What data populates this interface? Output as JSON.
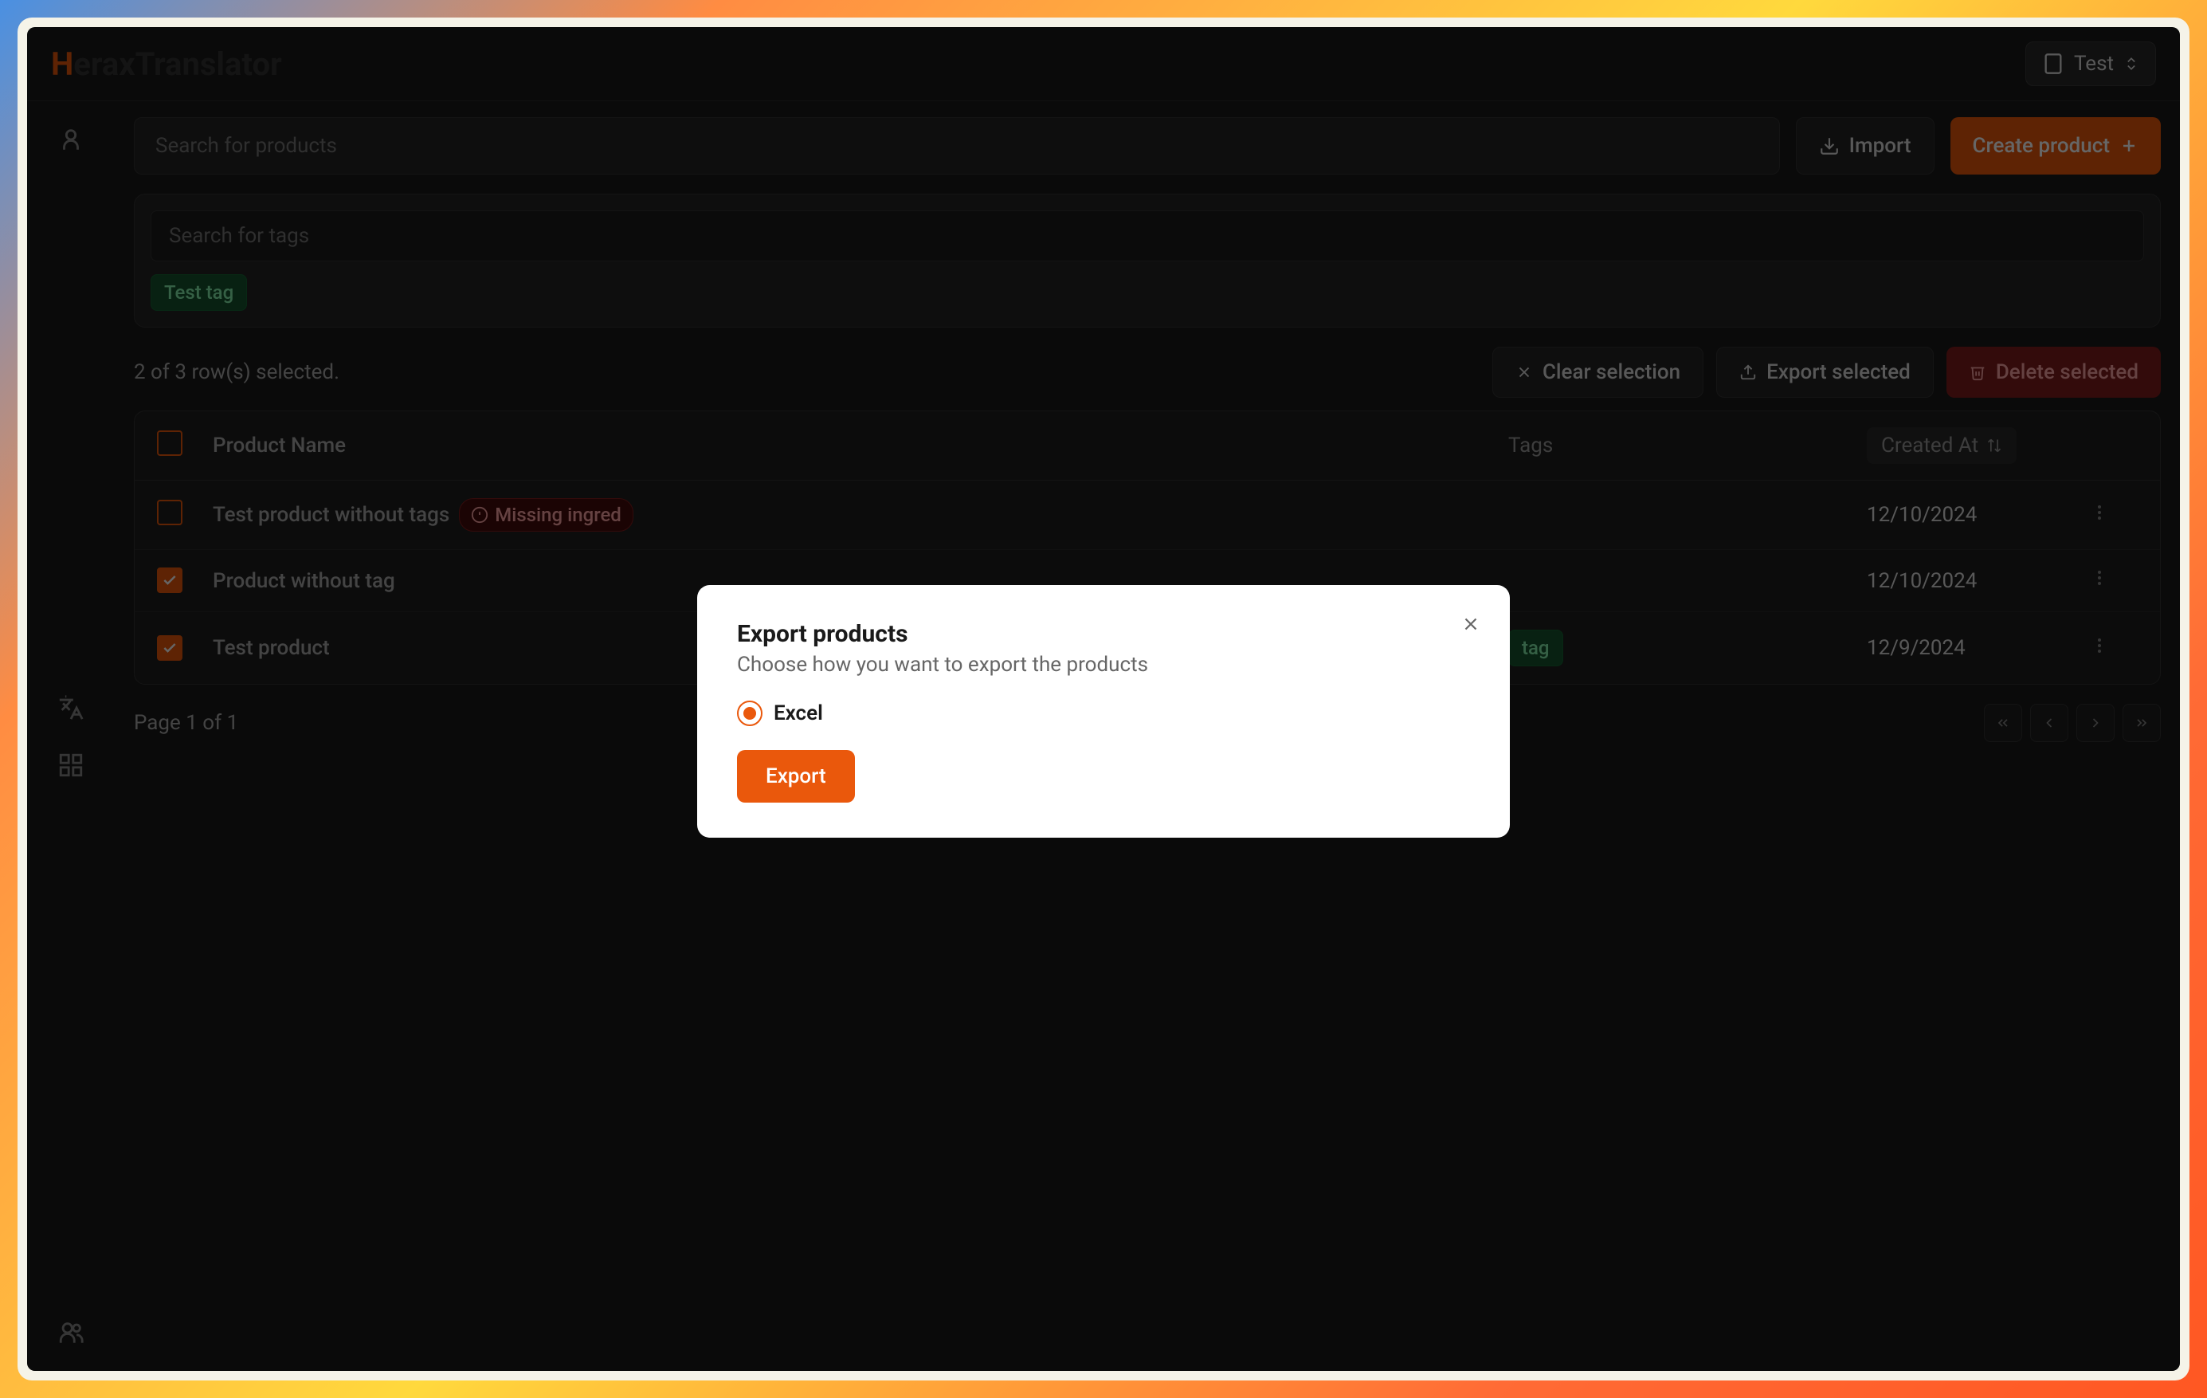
{
  "app_name_prefix": "H",
  "app_name_rest": "eraxTranslator",
  "header": {
    "org_label": "Test"
  },
  "toolbar": {
    "search_placeholder": "Search for products",
    "import_label": "Import",
    "create_label": "Create product"
  },
  "tag_filter": {
    "search_placeholder": "Search for tags",
    "active_tag": "Test tag"
  },
  "selection": {
    "text": "2 of 3 row(s) selected.",
    "clear_label": "Clear selection",
    "export_label": "Export selected",
    "delete_label": "Delete selected"
  },
  "table": {
    "columns": {
      "name": "Product Name",
      "tags": "Tags",
      "created": "Created At"
    },
    "rows": [
      {
        "checked": false,
        "name": "Test product without tags",
        "badge": "Missing ingred",
        "tag": "",
        "created": "12/10/2024"
      },
      {
        "checked": true,
        "name": "Product without tag",
        "badge": "",
        "tag": "",
        "created": "12/10/2024"
      },
      {
        "checked": true,
        "name": "Test product",
        "badge": "",
        "tag": "tag",
        "created": "12/9/2024"
      }
    ]
  },
  "pagination": {
    "text": "Page 1 of 1"
  },
  "modal": {
    "title": "Export products",
    "subtitle": "Choose how you want to export the products",
    "option_excel": "Excel",
    "export_button": "Export"
  }
}
